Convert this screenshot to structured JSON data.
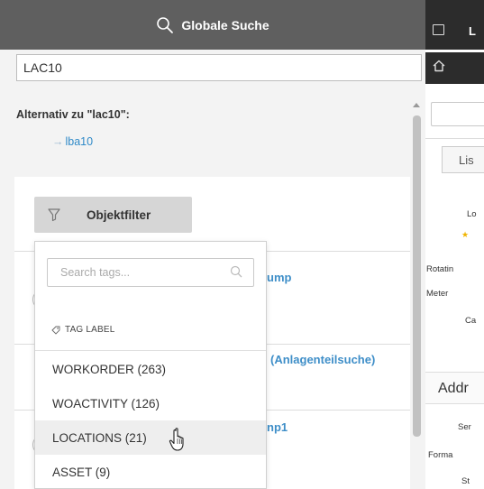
{
  "search": {
    "header_title": "Globale Suche",
    "query_value": "LAC10"
  },
  "alternative": {
    "heading": "Alternativ zu \"lac10\":",
    "arrow": "→",
    "link": "lba10"
  },
  "object_filter": {
    "label": "Objektfilter"
  },
  "tag_dropdown": {
    "search_placeholder": "Search tags...",
    "label_header": "TAG LABEL",
    "items": [
      {
        "label": "WORKORDER (263)"
      },
      {
        "label": "WOACTIVITY (126)"
      },
      {
        "label": "LOCATIONS (21)"
      },
      {
        "label": "ASSET (9)"
      }
    ]
  },
  "results": [
    {
      "title_fragment": "ump"
    },
    {
      "title_fragment": "(Anlagenteilsuche)"
    },
    {
      "title_fragment": "np1"
    }
  ],
  "right_panel": {
    "top_letter": "L",
    "tab_label": "Lis",
    "field_labels": [
      "Lo",
      "Rotatin",
      "Meter",
      "Ca",
      "Ser",
      "Forma",
      "St"
    ],
    "star": "★",
    "section_label": "Addr"
  },
  "icons": {
    "search": "search-icon",
    "filter": "funnel-icon",
    "tag": "tag-icon",
    "home": "home-icon",
    "panel_toggle": "panel-toggle-icon",
    "cursor": "hand-pointer-icon"
  },
  "colors": {
    "header_bg": "#5f5f5f",
    "link": "#2f8ac8",
    "result_title": "#3e8ec8",
    "right_header_bg": "#2c2c2c",
    "filter_button_bg": "#d6d6d6"
  }
}
